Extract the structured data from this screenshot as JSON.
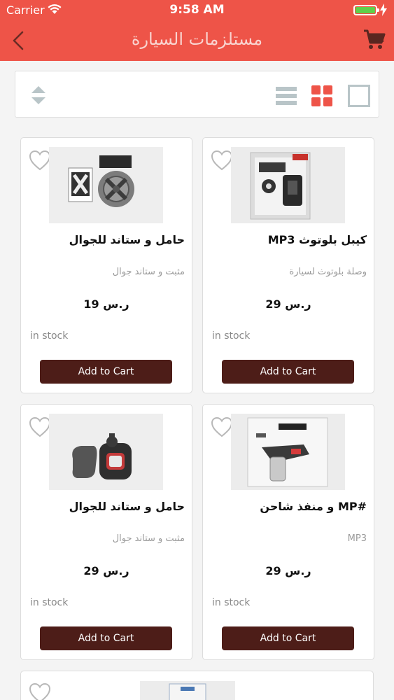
{
  "status_bar": {
    "carrier": "Carrier",
    "time": "9:58 AM",
    "battery_level": 1.0
  },
  "header": {
    "title": "مستلزمات السيارة"
  },
  "colors": {
    "primary": "#ee5448",
    "button": "#4d1d18",
    "grid_active": "#ee5448",
    "icon_muted": "#b9c5c8"
  },
  "toolbar": {
    "icons": [
      "sort-icon",
      "list-view-icon",
      "grid-view-icon",
      "single-view-icon"
    ],
    "active_view": "grid"
  },
  "products": [
    {
      "name": "MP3  كيبل بلوتوث",
      "description": "وصلة بلوتوث لسيارة",
      "price": "29 ر.س",
      "stock": "in stock",
      "cta": "Add to Cart"
    },
    {
      "name": "حامل و ستاند للجوال",
      "description": "مثبت و ستاند جوال",
      "price": "19 ر.س",
      "stock": "in stock",
      "cta": "Add to Cart"
    },
    {
      "name": "و منفذ شاحن MP#",
      "description": "MP3",
      "price": "29 ر.س",
      "stock": "in stock",
      "cta": "Add to Cart"
    },
    {
      "name": "حامل و ستاند للجوال",
      "description": "مثبت و ستاند جوال",
      "price": "29 ر.س",
      "stock": "in stock",
      "cta": "Add to Cart"
    }
  ]
}
